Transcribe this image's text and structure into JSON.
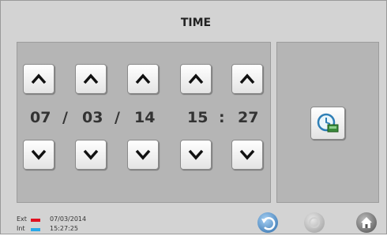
{
  "header": {
    "title": "TIME"
  },
  "time": {
    "day": "07",
    "month": "03",
    "year": "14",
    "hour": "15",
    "minute": "27",
    "date_sep": "/",
    "time_sep": ":"
  },
  "status": {
    "ext_label": "Ext",
    "int_label": "Int",
    "ext_color": "#e01020",
    "int_color": "#28a8e8",
    "ext_value": "07/03/2014",
    "int_value": "15:27:25"
  },
  "icons": {
    "save": "clock-save-icon",
    "back": "back-arrow-icon",
    "disabled": "disabled-icon",
    "home": "home-icon"
  }
}
